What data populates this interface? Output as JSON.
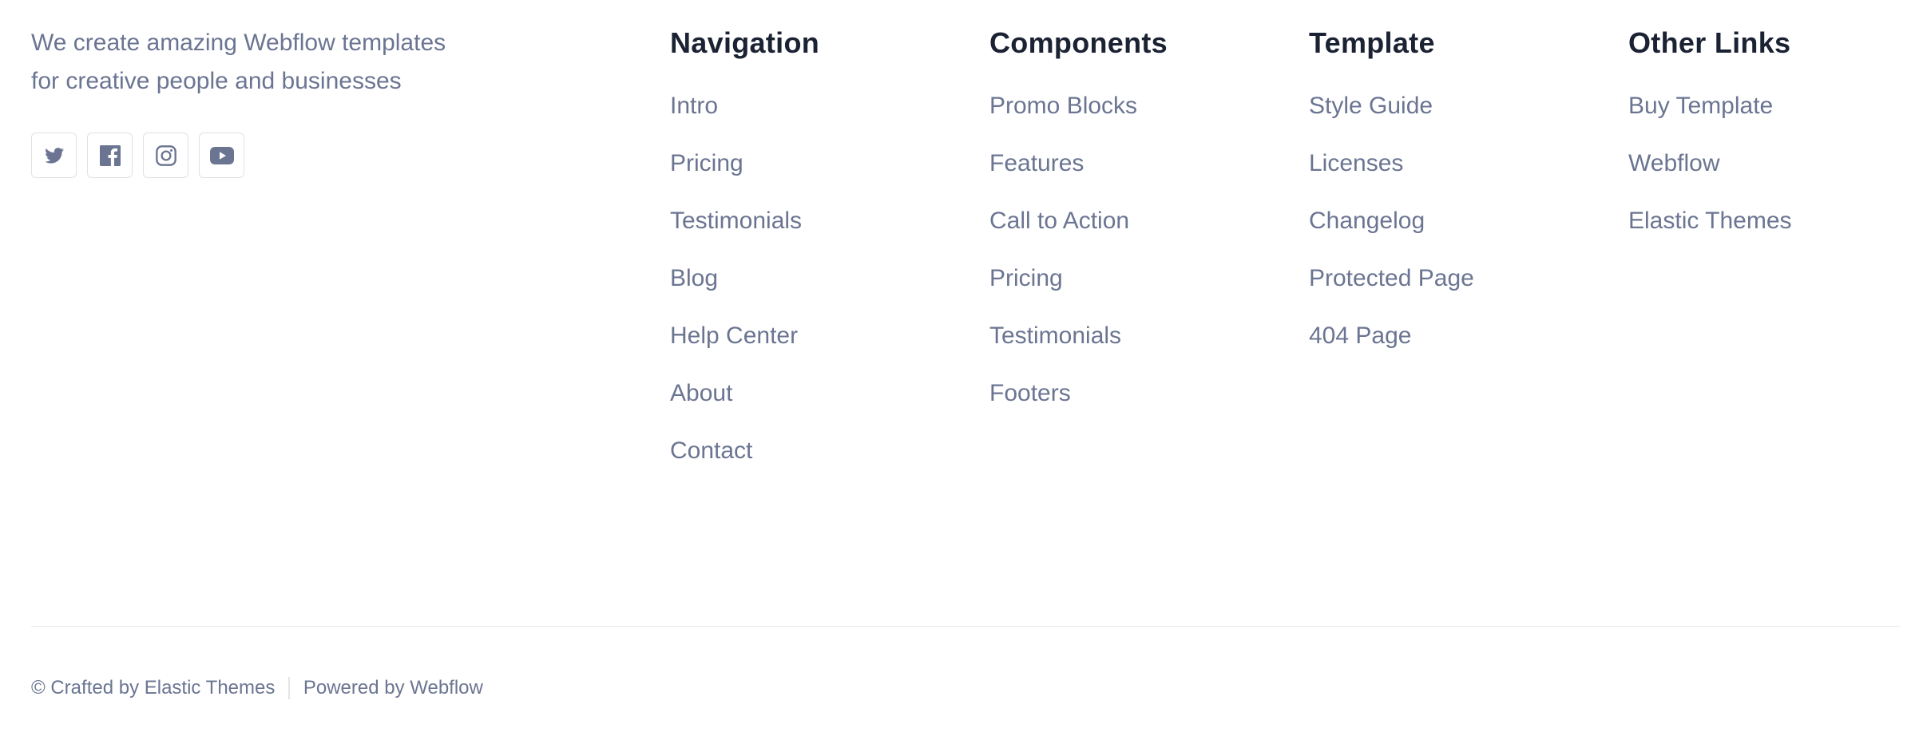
{
  "brand": {
    "tagline_line1": "We create amazing Webflow templates",
    "tagline_line2": "for creative people and businesses",
    "icon_color": "#6b7592",
    "socials": [
      {
        "icon": "twitter-icon"
      },
      {
        "icon": "facebook-icon"
      },
      {
        "icon": "instagram-icon"
      },
      {
        "icon": "youtube-icon"
      }
    ]
  },
  "columns": [
    {
      "title": "Navigation",
      "links": [
        "Intro",
        "Pricing",
        "Testimonials",
        "Blog",
        "Help Center",
        "About",
        "Contact"
      ]
    },
    {
      "title": "Components",
      "links": [
        "Promo Blocks",
        "Features",
        "Call to Action",
        "Pricing",
        "Testimonials",
        "Footers"
      ]
    },
    {
      "title": "Template",
      "links": [
        "Style Guide",
        "Licenses",
        "Changelog",
        "Protected Page",
        "404 Page"
      ]
    },
    {
      "title": "Other Links",
      "links": [
        "Buy Template",
        "Webflow",
        "Elastic Themes"
      ]
    }
  ],
  "bottom": {
    "crafted": "© Crafted by Elastic Themes",
    "powered": "Powered by Webflow"
  },
  "colors": {
    "text_muted": "#6b7592",
    "heading": "#1b2233",
    "border": "#dfe1e7"
  }
}
